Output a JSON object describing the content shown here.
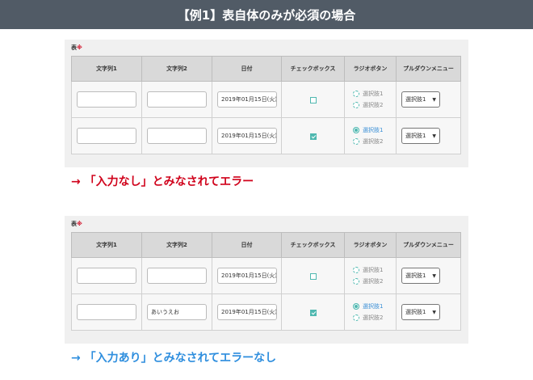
{
  "header": {
    "title": "【例1】表自体のみが必須の場合"
  },
  "colors": {
    "header_bg": "#515b66",
    "error": "#d0021b",
    "ok": "#2e8ede",
    "accent": "#4fb8b0"
  },
  "columns": [
    "文字列1",
    "文字列2",
    "日付",
    "チェックボックス",
    "ラジオボタン",
    "プルダウンメニュー"
  ],
  "example1": {
    "label": "表",
    "required_mark": "※",
    "rows": [
      {
        "text1": "",
        "text2": "",
        "date": "2019年01月15日(火)",
        "checked": false,
        "radio": [
          "選択肢1",
          "選択肢2"
        ],
        "radio_selected": -1,
        "select": "選択肢1",
        "select_arrow": "▼"
      },
      {
        "text1": "",
        "text2": "",
        "date": "2019年01月15日(火)",
        "checked": true,
        "radio": [
          "選択肢1",
          "選択肢2"
        ],
        "radio_selected": 0,
        "select": "選択肢1",
        "select_arrow": "▼"
      }
    ],
    "caption": "→ 「入力なし」とみなされてエラー"
  },
  "example2": {
    "label": "表",
    "required_mark": "※",
    "rows": [
      {
        "text1": "",
        "text2": "",
        "date": "2019年01月15日(火)",
        "checked": false,
        "radio": [
          "選択肢1",
          "選択肢2"
        ],
        "radio_selected": -1,
        "select": "選択肢1",
        "select_arrow": "▼"
      },
      {
        "text1": "",
        "text2": "あいうえお",
        "date": "2019年01月15日(火)",
        "checked": true,
        "radio": [
          "選択肢1",
          "選択肢2"
        ],
        "radio_selected": 0,
        "select": "選択肢1",
        "select_arrow": "▼"
      }
    ],
    "caption": "→ 「入力あり」とみなされてエラーなし"
  }
}
